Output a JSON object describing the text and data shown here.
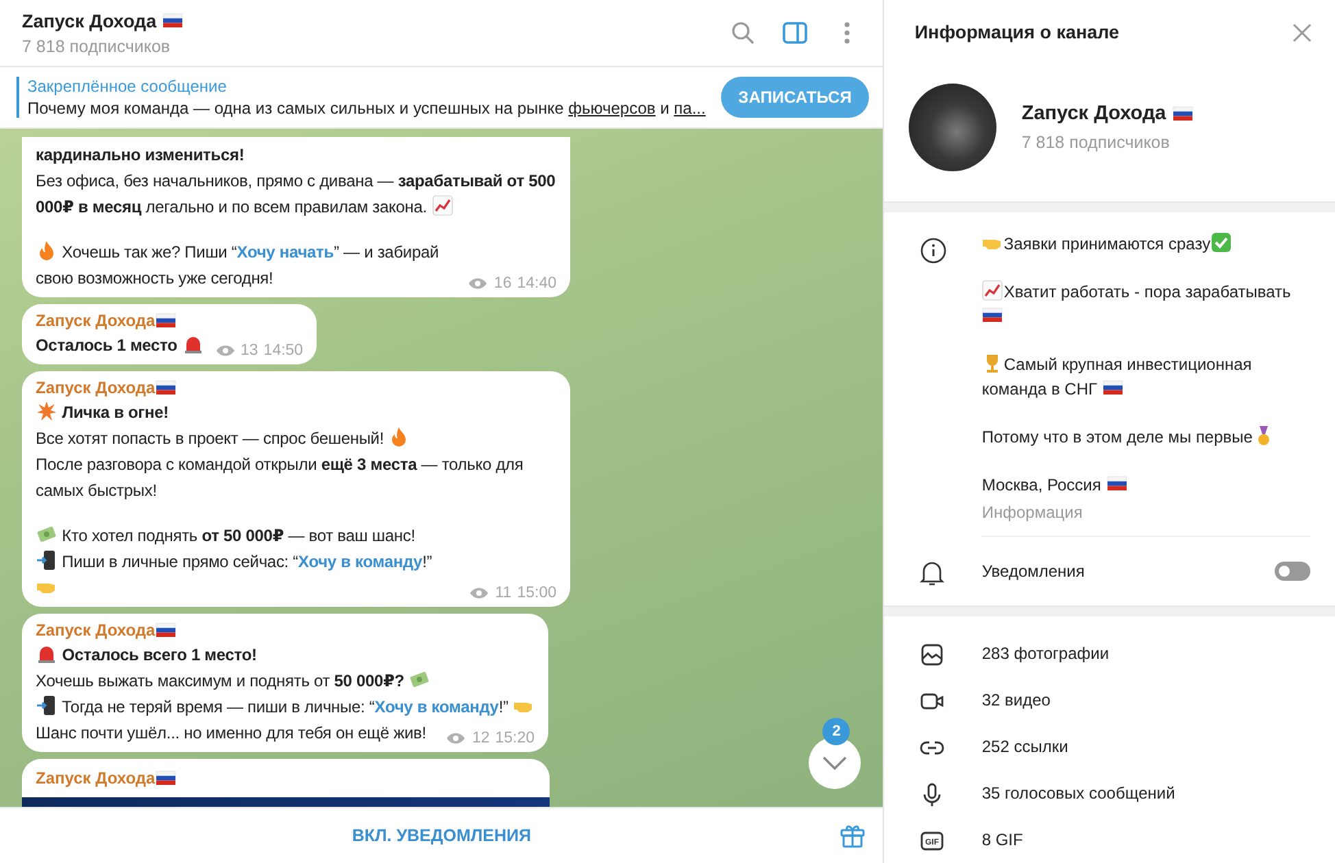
{
  "chat": {
    "title": [
      {
        "kind": "text",
        "text": "Zапуск Дохода"
      },
      {
        "kind": "flag"
      }
    ],
    "subtitle": "7 818 подписчиков",
    "header_icons": [
      {
        "kind": "search",
        "active": false
      },
      {
        "kind": "panel",
        "active": true
      },
      {
        "kind": "more",
        "active": false
      }
    ],
    "pinned": {
      "label": "Закреплённое сообщение",
      "text": [
        {
          "kind": "text",
          "text": "Почему моя команда — одна из самых сильных и успешных на рынке "
        },
        {
          "kind": "ulink",
          "text": "фьючерсов"
        },
        {
          "kind": "text",
          "text": " и "
        },
        {
          "kind": "ulink",
          "text": "па..."
        }
      ],
      "button": "ЗАПИСАТЬСЯ"
    },
    "messages": [
      {
        "kind": "text",
        "blocks": [
          [
            [
              {
                "kind": "text",
                "text": "**кардинально измениться!**"
              }
            ],
            [
              {
                "kind": "text",
                "text": "Без офиса, без начальников, прямо с дивана — **зарабатывай от 500 000₽ в месяц** легально и по всем правилам закона. "
              },
              {
                "kind": "chart"
              }
            ]
          ],
          [
            [
              {
                "kind": "fire"
              },
              {
                "kind": "text",
                "text": " Хочешь так же? Пиши “"
              },
              {
                "kind": "link",
                "text": "Хочу начать"
              },
              {
                "kind": "text",
                "text": "” — и забирай свою возможность уже сегодня!"
              }
            ]
          ]
        ],
        "views": "16",
        "time": "14:40"
      },
      {
        "kind": "text",
        "author": [
          {
            "kind": "text",
            "text": "Zапуск Дохода "
          },
          {
            "kind": "flag"
          }
        ],
        "blocks": [
          [
            [
              {
                "kind": "text",
                "text": "**Осталось 1 место** "
              },
              {
                "kind": "siren"
              }
            ]
          ]
        ],
        "views": "13",
        "time": "14:50"
      },
      {
        "kind": "text",
        "author": [
          {
            "kind": "text",
            "text": "Zапуск Дохода "
          },
          {
            "kind": "flag"
          }
        ],
        "blocks": [
          [
            [
              {
                "kind": "explosion"
              },
              {
                "kind": "text",
                "text": " **Личка в огне!**"
              }
            ],
            [
              {
                "kind": "text",
                "text": "Все хотят попасть в проект — спрос бешеный! "
              },
              {
                "kind": "fire"
              }
            ],
            [
              {
                "kind": "text",
                "text": "После разговора с командой открыли **ещё 3 места** — только для самых быстрых!"
              }
            ]
          ],
          [
            [
              {
                "kind": "money"
              },
              {
                "kind": "text",
                "text": " Кто хотел поднять **от 50 000₽** — вот ваш шанс!"
              }
            ],
            [
              {
                "kind": "phone"
              },
              {
                "kind": "text",
                "text": " Пиши в личные прямо сейчас: “"
              },
              {
                "kind": "link",
                "text": "Хочу в команду"
              },
              {
                "kind": "text",
                "text": "!” "
              },
              {
                "kind": "point"
              }
            ]
          ]
        ],
        "views": "11",
        "time": "15:00"
      },
      {
        "kind": "text",
        "author": [
          {
            "kind": "text",
            "text": "Zапуск Дохода "
          },
          {
            "kind": "flag"
          }
        ],
        "blocks": [
          [
            [
              {
                "kind": "siren"
              },
              {
                "kind": "text",
                "text": " **Осталось всего 1 место!**"
              }
            ],
            [
              {
                "kind": "text",
                "text": "Хочешь выжать максимум и поднять от **50 000₽?** "
              },
              {
                "kind": "money"
              }
            ],
            [
              {
                "kind": "phone"
              },
              {
                "kind": "text",
                "text": " Тогда не теряй время — пиши в личные: “"
              },
              {
                "kind": "link",
                "text": "Хочу в команду"
              },
              {
                "kind": "text",
                "text": "!” "
              },
              {
                "kind": "point"
              }
            ],
            [
              {
                "kind": "text",
                "text": "Шанс почти ушёл... но именно для тебя он ещё жив!"
              }
            ]
          ]
        ],
        "views": "12",
        "time": "15:20"
      },
      {
        "kind": "photo",
        "author": [
          {
            "kind": "text",
            "text": "Zапуск Дохода "
          },
          {
            "kind": "flag"
          }
        ]
      }
    ],
    "unread_badge": "2",
    "footer": "ВКЛ. УВЕДОМЛЕНИЯ"
  },
  "info_panel": {
    "title": "Информация о канале",
    "name": [
      {
        "kind": "text",
        "text": "Zапуск Дохода "
      },
      {
        "kind": "flag"
      }
    ],
    "subtitle": "7 818 подписчиков",
    "description": [
      [
        {
          "kind": "point"
        },
        {
          "kind": "text",
          "text": "Заявки принимаются сразу"
        },
        {
          "kind": "check"
        }
      ],
      [
        {
          "kind": "chart"
        },
        {
          "kind": "text",
          "text": "Хватит работать - пора зарабатывать "
        },
        {
          "kind": "flag"
        }
      ],
      [
        {
          "kind": "trophy"
        },
        {
          "kind": "text",
          "text": "Самый крупная инвестиционная команда в СНГ "
        },
        {
          "kind": "flag"
        }
      ],
      [
        {
          "kind": "text",
          "text": "Потому что в этом деле мы первые"
        },
        {
          "kind": "medal"
        }
      ],
      [
        {
          "kind": "text",
          "text": "Москва, Россия "
        },
        {
          "kind": "flag"
        }
      ]
    ],
    "description_caption": "Информация",
    "notifications": {
      "label": "Уведомления",
      "on": false
    },
    "media": [
      {
        "kind": "photo",
        "label": "283 фотографии"
      },
      {
        "kind": "video",
        "label": "32 видео"
      },
      {
        "kind": "link",
        "label": "252 ссылки"
      },
      {
        "kind": "voice",
        "label": "35 голосовых сообщений"
      },
      {
        "kind": "gif",
        "label": "8 GIF",
        "icon_text": "GIF"
      }
    ]
  }
}
